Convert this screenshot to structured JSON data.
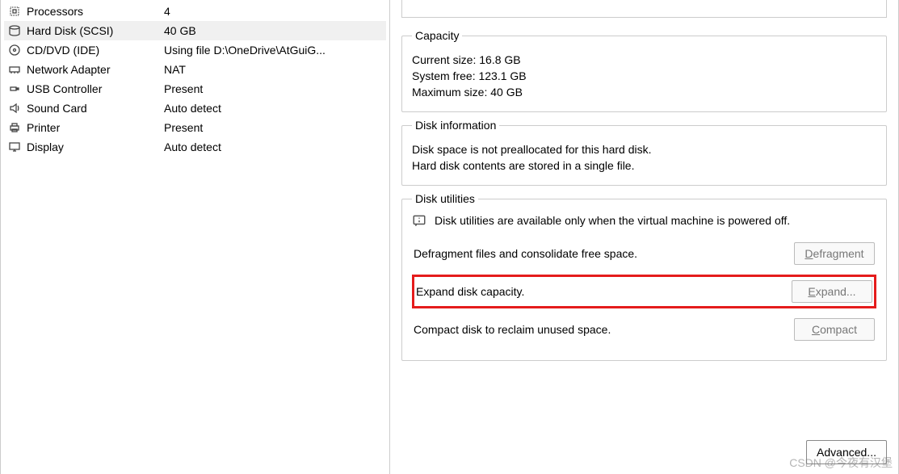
{
  "hardware": {
    "items": [
      {
        "key": "processors",
        "name": "Processors",
        "value": "4"
      },
      {
        "key": "hard-disk",
        "name": "Hard Disk (SCSI)",
        "value": "40 GB",
        "selected": true
      },
      {
        "key": "cd-dvd",
        "name": "CD/DVD (IDE)",
        "value": "Using file D:\\OneDrive\\AtGuiG..."
      },
      {
        "key": "network",
        "name": "Network Adapter",
        "value": "NAT"
      },
      {
        "key": "usb",
        "name": "USB Controller",
        "value": "Present"
      },
      {
        "key": "sound",
        "name": "Sound Card",
        "value": "Auto detect"
      },
      {
        "key": "printer",
        "name": "Printer",
        "value": "Present"
      },
      {
        "key": "display",
        "name": "Display",
        "value": "Auto detect"
      }
    ]
  },
  "capacity": {
    "legend": "Capacity",
    "current_label": "Current size:",
    "current_value": "16.8 GB",
    "sysfree_label": "System free:",
    "sysfree_value": "123.1 GB",
    "max_label": "Maximum size:",
    "max_value": "40 GB"
  },
  "disk_info": {
    "legend": "Disk information",
    "line1": "Disk space is not preallocated for this hard disk.",
    "line2": "Hard disk contents are stored in a single file."
  },
  "utilities": {
    "legend": "Disk utilities",
    "note": "Disk utilities are available only when the virtual machine is powered off.",
    "defrag_text": "Defragment files and consolidate free space.",
    "defrag_btn": "Defragment",
    "expand_text": "Expand disk capacity.",
    "expand_btn": "Expand...",
    "compact_text": "Compact disk to reclaim unused space.",
    "compact_btn": "Compact"
  },
  "actions": {
    "advanced": "Advanced..."
  },
  "watermark": "CSDN @今夜有汉堡"
}
